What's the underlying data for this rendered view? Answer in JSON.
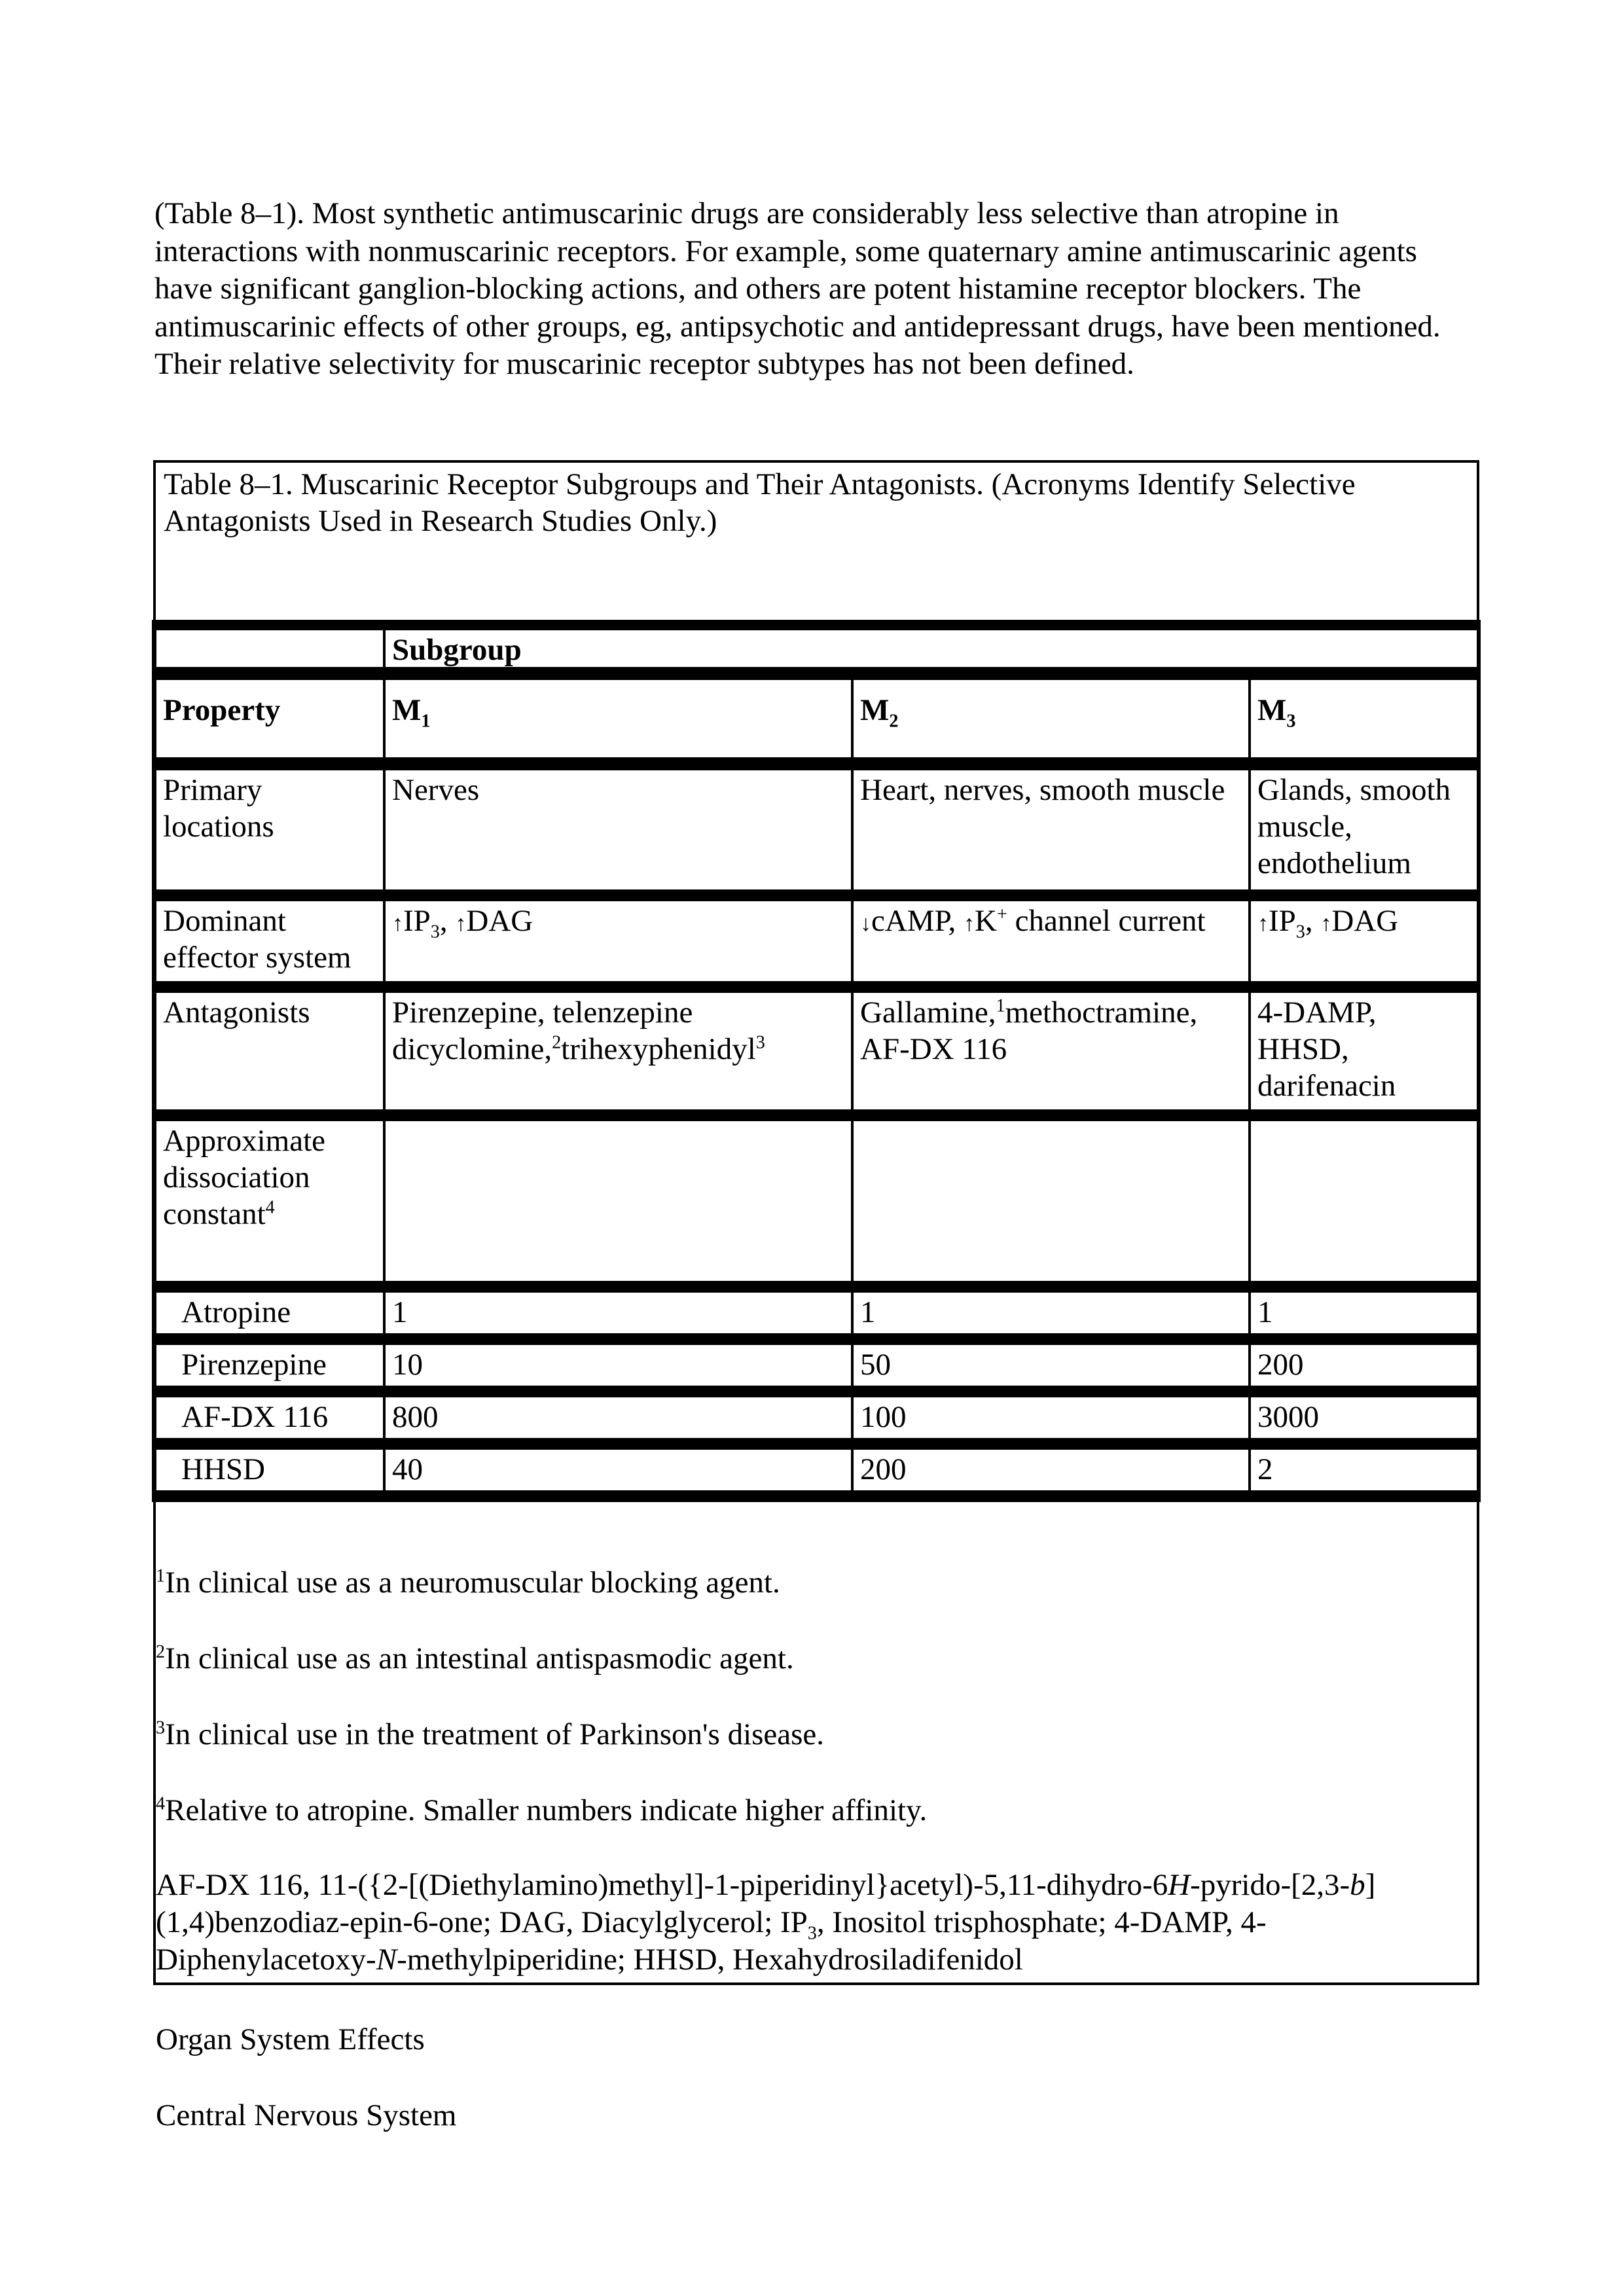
{
  "intro_paragraph": "(Table 8–1). Most synthetic antimuscarinic drugs are considerably less selective than atropine in interactions with nonmuscarinic receptors. For example, some quaternary amine antimuscarinic agents have significant ganglion-blocking actions, and others are potent histamine receptor blockers. The antimuscarinic effects of other groups, eg, antipsychotic and antidepressant drugs, have been mentioned. Their relative selectivity for muscarinic receptor subtypes has not been defined.",
  "table": {
    "title": "Table 8–1. Muscarinic Receptor Subgroups and Their Antagonists. (Acronyms Identify Selective Antagonists Used in Research Studies Only.)",
    "subgroup_header": "Subgroup",
    "property_header": "Property",
    "columns": [
      {
        "base": "M",
        "sub": "1"
      },
      {
        "base": "M",
        "sub": "2"
      },
      {
        "base": "M",
        "sub": "3"
      }
    ],
    "rows": {
      "primary_locations": {
        "label": "Primary locations",
        "values": [
          "Nerves",
          "Heart, nerves, smooth muscle",
          "Glands, smooth muscle, endothelium"
        ]
      },
      "dominant_effector": {
        "label": "Dominant effector system",
        "m1": {
          "arrow1": "↑",
          "t1": "IP",
          "s1": "3",
          "t2": ", ",
          "arrow2": "↑",
          "t3": "DAG"
        },
        "m2": {
          "arrow1": "↓",
          "t1": "cAMP, ",
          "arrow2": "↑",
          "t2": "K",
          "sup": "+",
          "t3": " channel current"
        },
        "m3": {
          "arrow1": "↑",
          "t1": "IP",
          "s1": "3",
          "t2": ", ",
          "arrow2": "↑",
          "t3": "DAG"
        }
      },
      "antagonists": {
        "label": "Antagonists",
        "m1": {
          "line1": "Pirenzepine, telenzepine",
          "t1": "dicyclomine,",
          "sup1": "2",
          "t2": "trihexyphenidyl",
          "sup2": "3"
        },
        "m2": {
          "t1": "Gallamine,",
          "sup1": "1",
          "t2": "methoctramine,",
          "line2": "AF-DX 116"
        },
        "m3": "4-DAMP, HHSD, darifenacin"
      },
      "dissociation": {
        "label": "Approximate dissociation constant",
        "label_sup": "4"
      },
      "drugs": [
        {
          "name": "Atropine",
          "values": [
            "1",
            "1",
            "1"
          ]
        },
        {
          "name": "Pirenzepine",
          "values": [
            "10",
            "50",
            "200"
          ]
        },
        {
          "name": "AF-DX 116",
          "values": [
            "800",
            "100",
            "3000"
          ]
        },
        {
          "name": "HHSD",
          "values": [
            "40",
            "200",
            "2"
          ]
        }
      ]
    },
    "footnotes": [
      {
        "mark": "1",
        "text": "In clinical use as a neuromuscular blocking agent."
      },
      {
        "mark": "2",
        "text": "In clinical use as an intestinal antispasmodic agent."
      },
      {
        "mark": "3",
        "text": "In clinical use in the treatment of Parkinson's disease."
      },
      {
        "mark": "4",
        "text": "Relative to atropine. Smaller numbers indicate higher affinity."
      }
    ],
    "abbreviations": {
      "p1": "AF-DX 116, 11-({2-[(Diethylamino)methyl]-1-piperidinyl}acetyl)-5,11-dihydro-6",
      "i1": "H",
      "p2": "-pyrido-[2,3-",
      "i2": "b",
      "p3": "](1,4)benzodiaz-epin-6-one; DAG, Diacylglycerol; IP",
      "s1": "3",
      "p4": ", Inositol trisphosphate; 4-DAMP, 4-Diphenylacetoxy-",
      "i3": "N",
      "p5": "-methylpiperidine; HHSD, Hexahydrosiladifenidol"
    }
  },
  "headings": [
    "Organ System Effects",
    "Central Nervous System"
  ]
}
